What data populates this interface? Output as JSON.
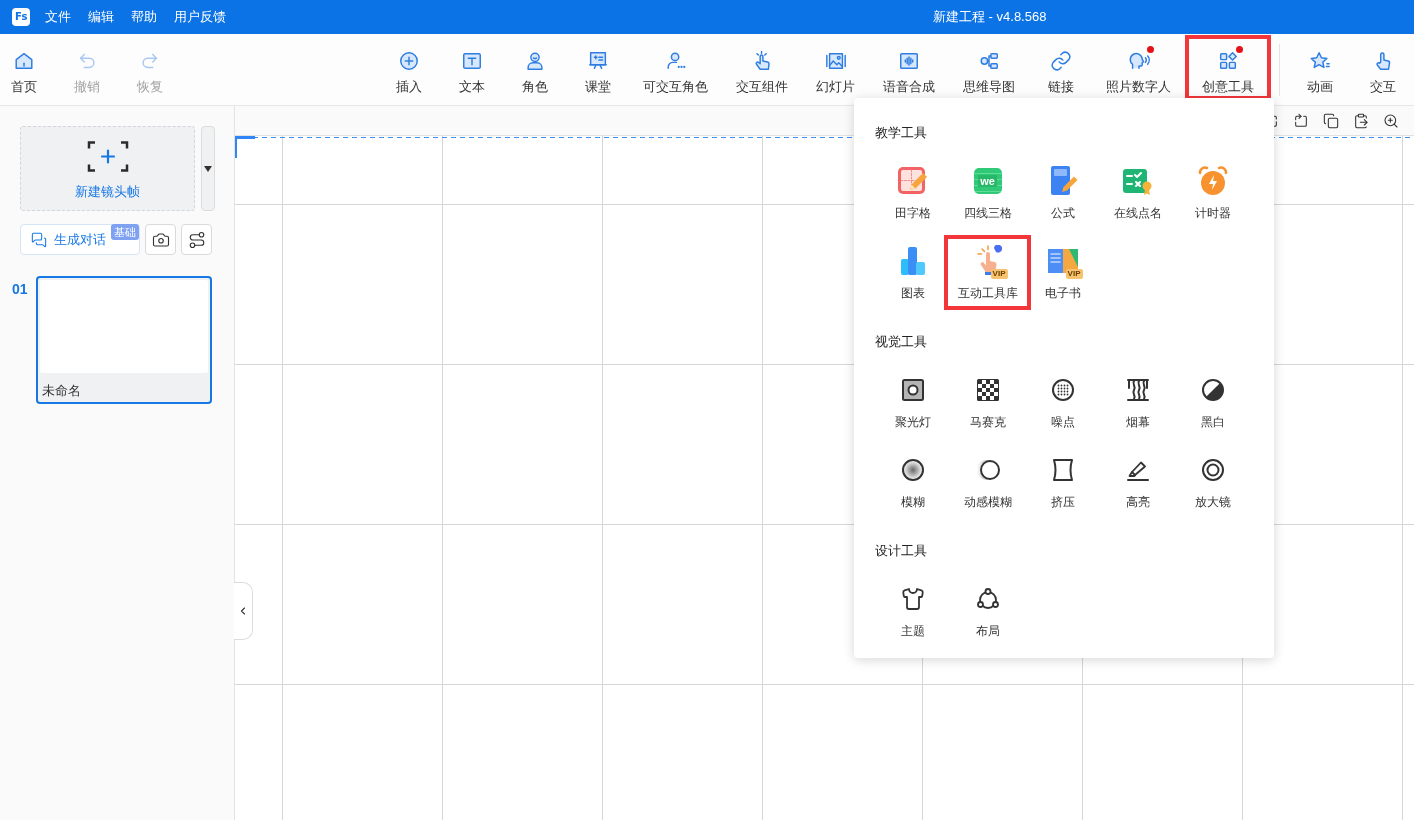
{
  "title_bar": {
    "logo": "Fs",
    "menu": [
      "文件",
      "编辑",
      "帮助",
      "用户反馈"
    ],
    "title": "新建工程 - v4.8.568"
  },
  "toolbar": {
    "left": [
      {
        "label": "首页",
        "disabled": false
      },
      {
        "label": "撤销",
        "disabled": true
      },
      {
        "label": "恢复",
        "disabled": true
      }
    ],
    "main": [
      {
        "label": "插入",
        "badge_dot": false,
        "highlighted": false
      },
      {
        "label": "文本",
        "badge_dot": false,
        "highlighted": false
      },
      {
        "label": "角色",
        "badge_dot": false,
        "highlighted": false
      },
      {
        "label": "课堂",
        "badge_dot": false,
        "highlighted": false
      },
      {
        "label": "可交互角色",
        "badge_dot": false,
        "highlighted": false
      },
      {
        "label": "交互组件",
        "badge_dot": false,
        "highlighted": false
      },
      {
        "label": "幻灯片",
        "badge_dot": false,
        "highlighted": false
      },
      {
        "label": "语音合成",
        "badge_dot": false,
        "highlighted": false
      },
      {
        "label": "思维导图",
        "badge_dot": false,
        "highlighted": false
      },
      {
        "label": "链接",
        "badge_dot": false,
        "highlighted": false
      },
      {
        "label": "照片数字人",
        "badge_dot": true,
        "highlighted": false
      },
      {
        "label": "创意工具",
        "badge_dot": true,
        "highlighted": true
      }
    ],
    "end": [
      {
        "label": "动画",
        "badge_dot": false,
        "highlighted": false
      },
      {
        "label": "交互",
        "badge_dot": false,
        "highlighted": false
      }
    ]
  },
  "left_panel": {
    "new_frame": {
      "label": "新建镜头帧"
    },
    "dialog_button": {
      "label": "生成对话",
      "badge": "基础"
    },
    "slides": [
      {
        "number": "01",
        "name": "未命名",
        "selected": true
      }
    ]
  },
  "tools_menu": {
    "sections": [
      {
        "title": "教学工具",
        "tools": [
          {
            "label": "田字格",
            "highlighted": false
          },
          {
            "label": "四线三格",
            "icon_text": "we",
            "highlighted": false
          },
          {
            "label": "公式",
            "highlighted": false
          },
          {
            "label": "在线点名",
            "highlighted": false
          },
          {
            "label": "计时器",
            "highlighted": false
          },
          {
            "label": "图表",
            "highlighted": false
          },
          {
            "label": "互动工具库",
            "badge": "VIP",
            "highlighted": true
          },
          {
            "label": "电子书",
            "badge": "VIP",
            "highlighted": false
          }
        ]
      },
      {
        "title": "视觉工具",
        "tools": [
          {
            "label": "聚光灯",
            "highlighted": false
          },
          {
            "label": "马赛克",
            "highlighted": false
          },
          {
            "label": "噪点",
            "highlighted": false
          },
          {
            "label": "烟幕",
            "highlighted": false
          },
          {
            "label": "黑白",
            "highlighted": false
          },
          {
            "label": "模糊",
            "highlighted": false
          },
          {
            "label": "动感模糊",
            "highlighted": false
          },
          {
            "label": "挤压",
            "highlighted": false
          },
          {
            "label": "高亮",
            "highlighted": false
          },
          {
            "label": "放大镜",
            "highlighted": false
          }
        ]
      },
      {
        "title": "设计工具",
        "tools": [
          {
            "label": "主题",
            "highlighted": false
          },
          {
            "label": "布局",
            "highlighted": false
          }
        ]
      }
    ]
  }
}
